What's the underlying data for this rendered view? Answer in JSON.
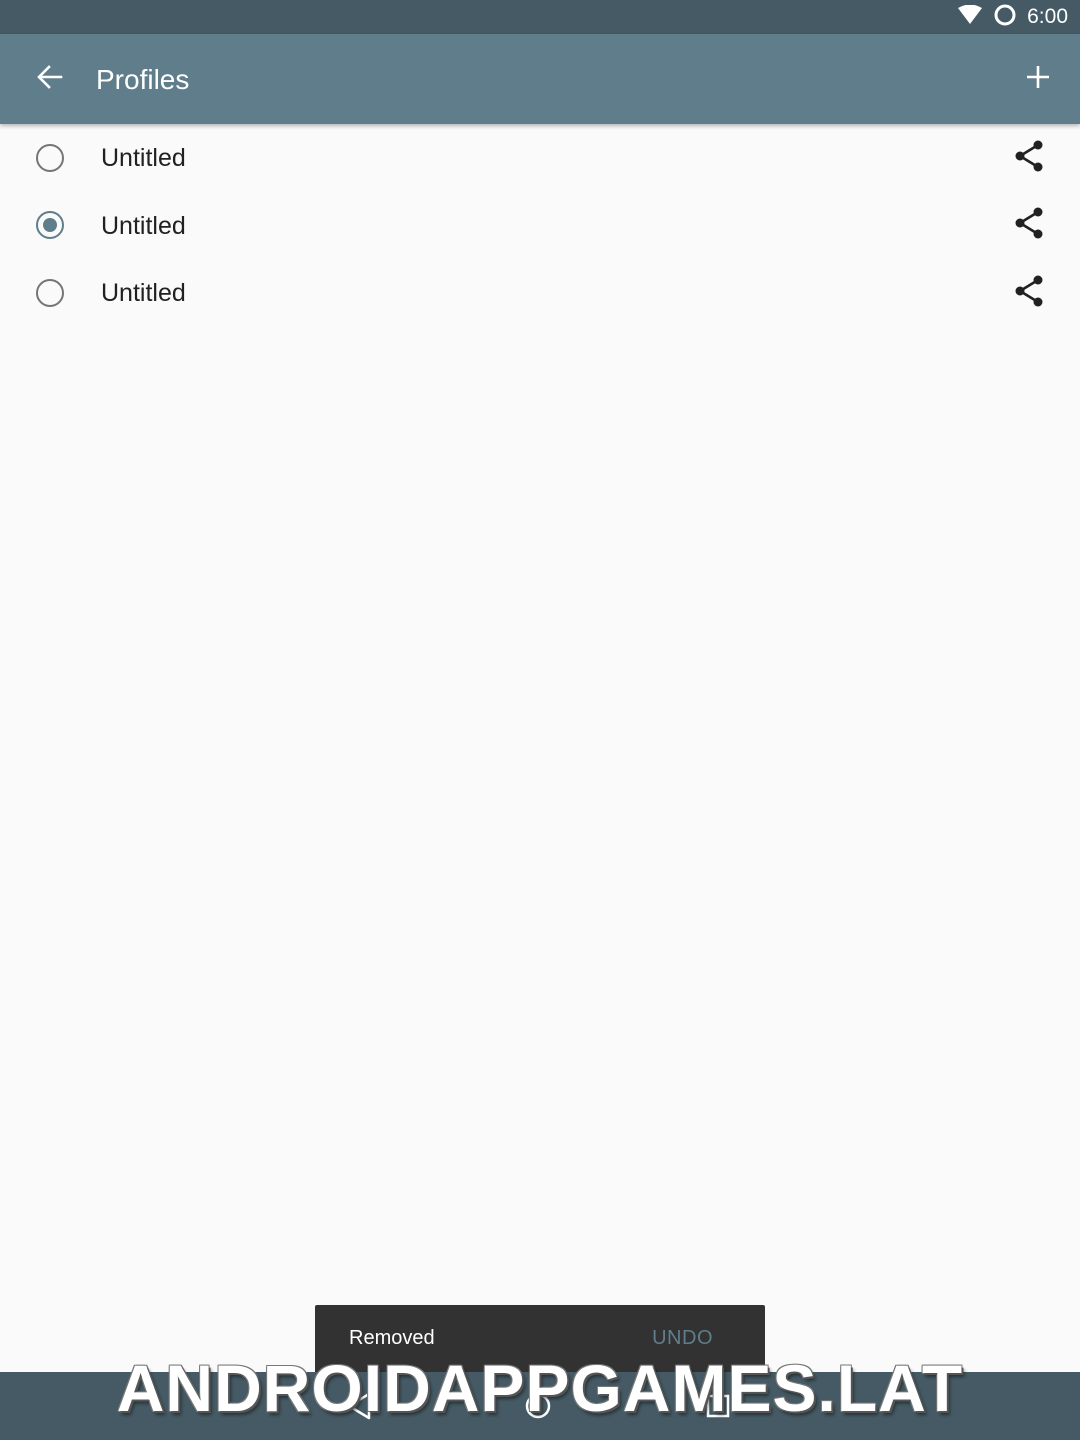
{
  "status_bar": {
    "time": "6:00",
    "icons": [
      "wifi-icon",
      "sync-icon"
    ]
  },
  "app_bar": {
    "title": "Profiles",
    "back_icon": "arrow-back-icon",
    "add_icon": "add-icon"
  },
  "profiles": [
    {
      "name": "Untitled",
      "selected": false,
      "share_icon": "share-icon"
    },
    {
      "name": "Untitled",
      "selected": true,
      "share_icon": "share-icon"
    },
    {
      "name": "Untitled",
      "selected": false,
      "share_icon": "share-icon"
    }
  ],
  "snackbar": {
    "message": "Removed",
    "action": "UNDO"
  },
  "navigation_bar": {
    "icons": [
      "nav-back-icon",
      "nav-home-icon",
      "nav-recents-icon"
    ]
  },
  "watermark": "ANDROIDAPPGAMES.LAT",
  "colors": {
    "status_bar": "#455a64",
    "app_bar": "#607d8b",
    "accent": "#607d8b",
    "background": "#fafafa",
    "snackbar": "#323232"
  }
}
